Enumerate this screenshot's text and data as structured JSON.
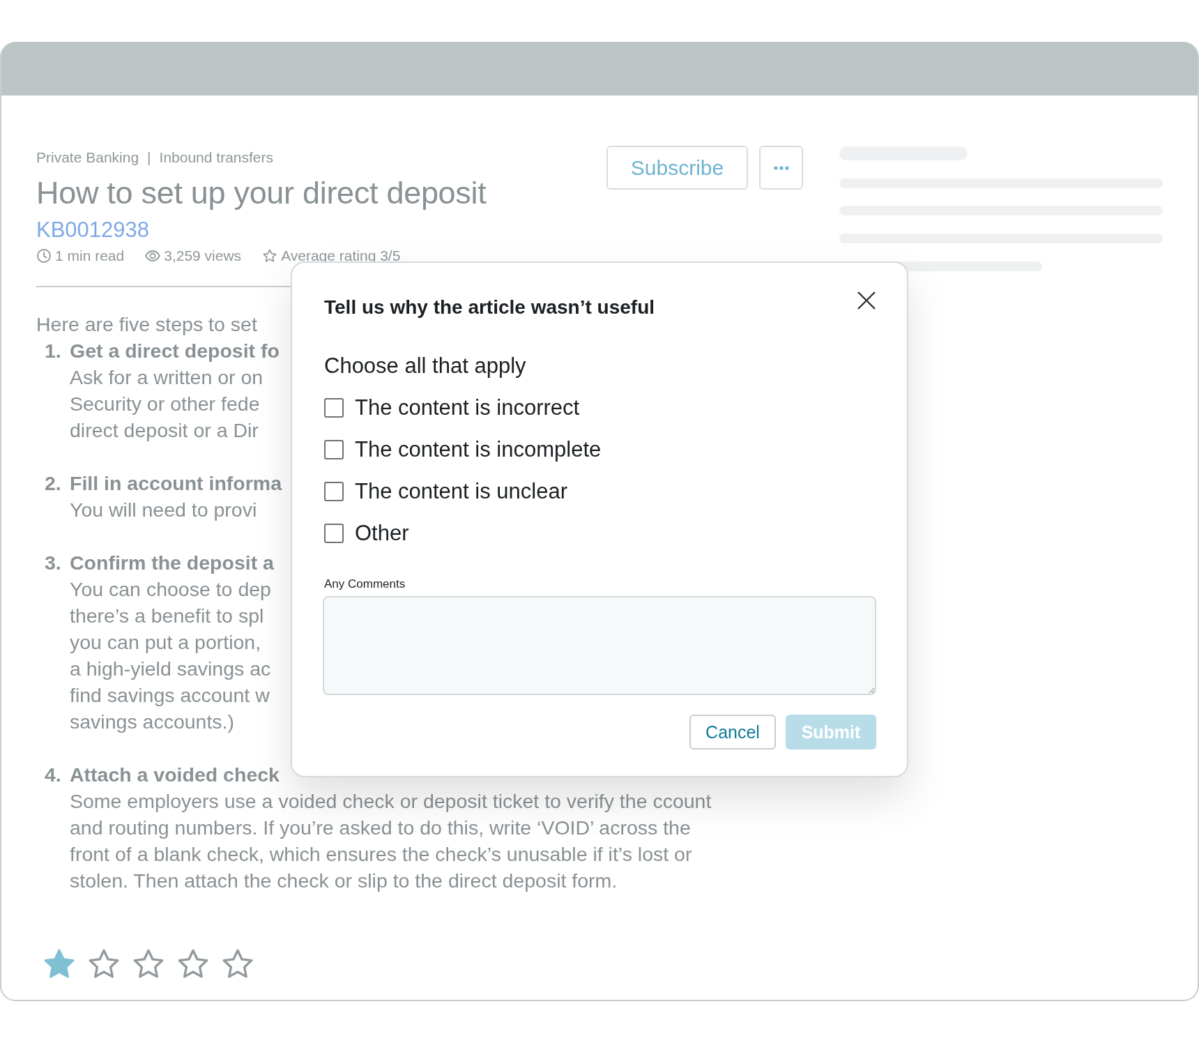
{
  "breadcrumb": {
    "items": [
      "Private Banking",
      "Inbound transfers"
    ],
    "separator": "|"
  },
  "actions": {
    "subscribe": "Subscribe"
  },
  "article": {
    "title": "How to set up your direct deposit",
    "id": "KB0012938",
    "meta": [
      {
        "kind": "time",
        "text": "1 min read"
      },
      {
        "kind": "views",
        "text": "3,259 views"
      },
      {
        "kind": "rating",
        "text": "Average rating 3/5"
      }
    ],
    "intro": "Here are five steps to set",
    "steps": [
      {
        "number": "1.",
        "title": "Get a direct deposit fo",
        "body": [
          "Ask for a written or on",
          "Security or other fede",
          "direct deposit or a Dir"
        ]
      },
      {
        "number": "2.",
        "title": "Fill in account informa",
        "body": [
          "You will need to provi"
        ]
      },
      {
        "number": "3.",
        "title": "Confirm the deposit a",
        "body": [
          "You can choose to dep",
          "there’s a benefit to spl",
          "you can put a portion,",
          "a high-yield savings ac",
          "find savings account w",
          "savings accounts.)"
        ]
      },
      {
        "number": "4.",
        "title": "Attach a voided check",
        "body": [
          "Some employers use a voided check or deposit ticket to verify the ccount",
          "and routing numbers. If you’re asked to do this, write ‘VOID’ across the",
          "front of a blank check, which ensures the check’s unusable if it’s lost or",
          "stolen. Then attach the check or slip to the direct deposit form."
        ]
      }
    ],
    "rating": {
      "stars": 1
    }
  },
  "modal": {
    "title": "Tell us why the article wasn’t useful",
    "prompt": "Choose all that apply",
    "options": [
      {
        "label": "The content is incorrect",
        "checked": false
      },
      {
        "label": "The content is incomplete",
        "checked": false
      },
      {
        "label": "The content is unclear",
        "checked": false
      },
      {
        "label": "Other",
        "checked": false
      }
    ],
    "comments_label": "Any Comments",
    "cancel": "Cancel",
    "submit": {
      "label": "Submit",
      "disabled": true
    }
  }
}
